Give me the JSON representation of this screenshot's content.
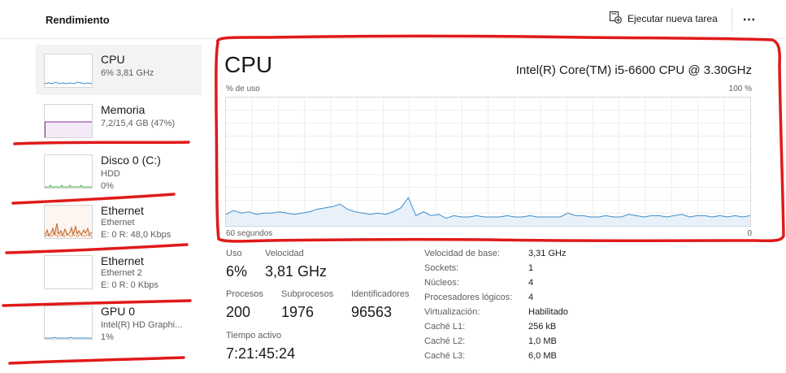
{
  "header": {
    "title": "Rendimiento",
    "run_task_label": "Ejecutar nueva tarea",
    "more_label": "⋯"
  },
  "sidebar": {
    "items": [
      {
        "name": "CPU",
        "sub1": "6% 3,81 GHz",
        "sub2": ""
      },
      {
        "name": "Memoria",
        "sub1": "7,2/15,4 GB (47%)",
        "sub2": ""
      },
      {
        "name": "Disco 0 (C:)",
        "sub1": "HDD",
        "sub2": "0%"
      },
      {
        "name": "Ethernet",
        "sub1": "Ethernet",
        "sub2": "E: 0 R: 48,0 Kbps"
      },
      {
        "name": "Ethernet",
        "sub1": "Ethernet 2",
        "sub2": "E: 0 R: 0 Kbps"
      },
      {
        "name": "GPU 0",
        "sub1": "Intel(R) HD Graphi...",
        "sub2": "1%"
      }
    ]
  },
  "main": {
    "title": "CPU",
    "model": "Intel(R) Core(TM) i5-6600 CPU @ 3.30GHz",
    "graph": {
      "y_label": "% de uso",
      "y_max_label": "100 %",
      "x_label": "60 segundos",
      "x_min_label": "0",
      "usage_series": [
        9,
        12,
        10,
        11,
        9,
        10,
        10,
        11,
        10,
        9,
        10,
        11,
        13,
        14,
        15,
        17,
        13,
        11,
        10,
        9,
        10,
        9,
        11,
        14,
        22,
        8,
        11,
        8,
        9,
        6,
        8,
        7,
        7,
        8,
        7,
        7,
        7,
        8,
        7,
        7,
        8,
        7,
        7,
        7,
        7,
        10,
        8,
        8,
        7,
        7,
        8,
        7,
        7,
        9,
        8,
        7,
        8,
        8,
        7,
        8,
        9,
        7,
        8,
        8,
        7,
        8,
        7,
        8,
        7,
        8
      ]
    },
    "stats": {
      "uso_label": "Uso",
      "uso_value": "6%",
      "velocidad_label": "Velocidad",
      "velocidad_value": "3,81 GHz",
      "procesos_label": "Procesos",
      "procesos_value": "200",
      "subprocesos_label": "Subprocesos",
      "subprocesos_value": "1976",
      "identificadores_label": "Identificadores",
      "identificadores_value": "96563",
      "tiempo_label": "Tiempo activo",
      "tiempo_value": "7:21:45:24"
    },
    "specs": [
      {
        "key": "Velocidad de base:",
        "value": "3,31 GHz"
      },
      {
        "key": "Sockets:",
        "value": "1"
      },
      {
        "key": "Núcleos:",
        "value": "4"
      },
      {
        "key": "Procesadores lógicos:",
        "value": "4"
      },
      {
        "key": "Virtualización:",
        "value": "Habilitado"
      },
      {
        "key": "Caché L1:",
        "value": "256 kB"
      },
      {
        "key": "Caché L2:",
        "value": "1,0 MB"
      },
      {
        "key": "Caché L3:",
        "value": "6,0 MB"
      }
    ]
  },
  "colors": {
    "cpu_line": "#3c8cc8",
    "cpu_fill": "#e8f1f9",
    "memory": "#8b2f9c",
    "disk": "#4caf50",
    "ethernet": "#c0662a",
    "annotation": "#e01a1a"
  }
}
